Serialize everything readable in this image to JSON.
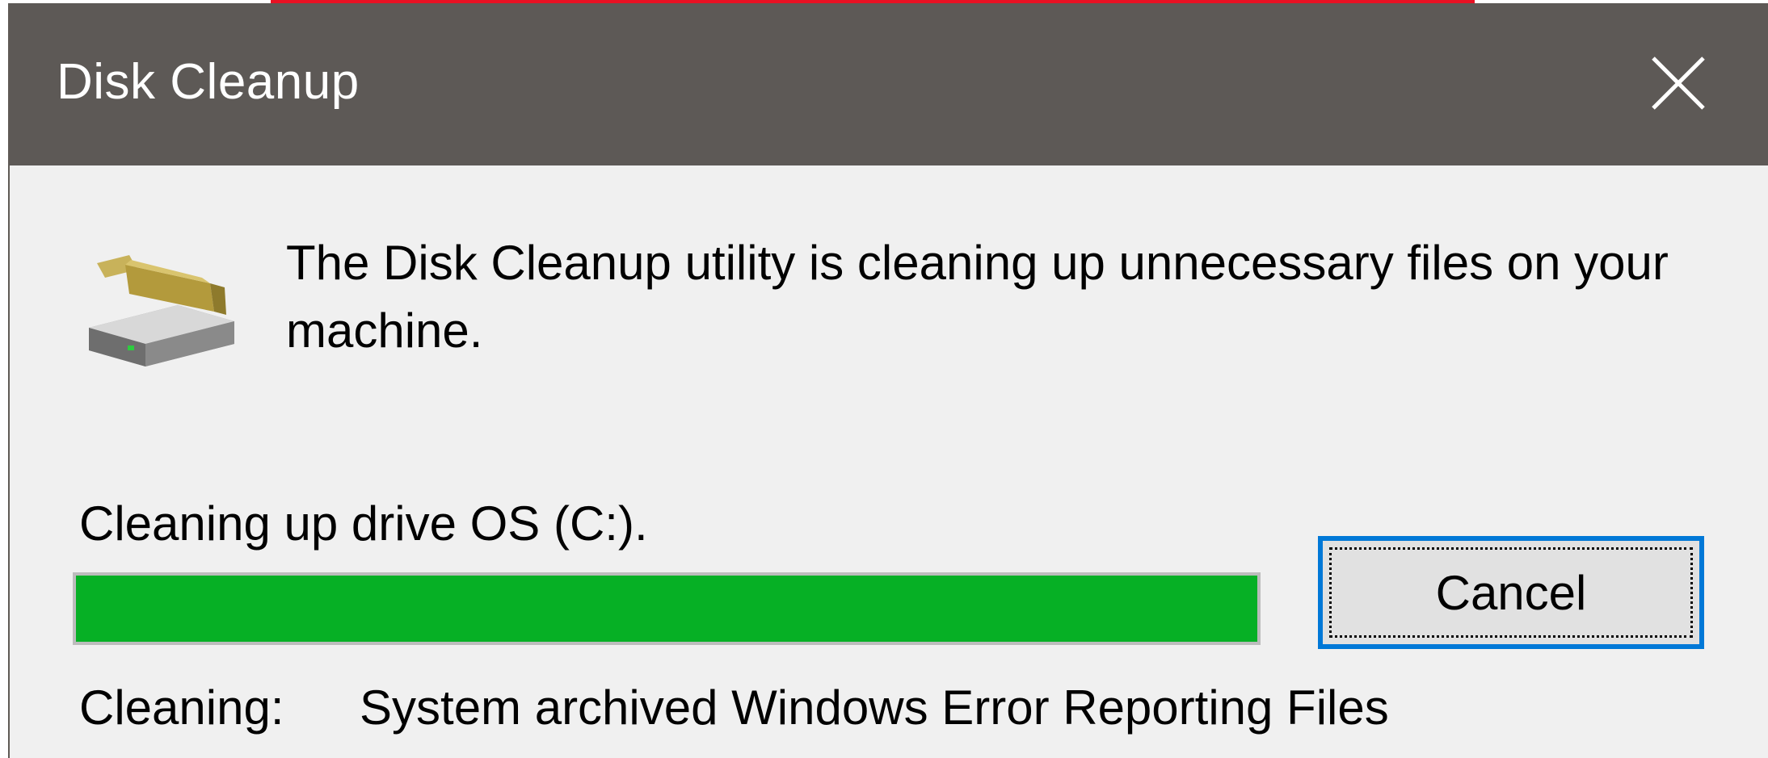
{
  "window": {
    "title": "Disk Cleanup",
    "close_icon": "close-icon"
  },
  "dialog": {
    "app_icon": "disk-cleanup-icon",
    "message": "The Disk Cleanup utility is cleaning up unnecessary files on your machine.",
    "status": "Cleaning up drive OS (C:).",
    "progress": {
      "value": 1.0,
      "fill_color": "#06b025"
    },
    "cancel_label": "Cancel",
    "cleaning_label": "Cleaning:",
    "cleaning_item": "System archived Windows Error Reporting Files"
  },
  "colors": {
    "titlebar": "#5d5956",
    "accent_focus": "#0078d7",
    "top_accent": "#e81123"
  }
}
